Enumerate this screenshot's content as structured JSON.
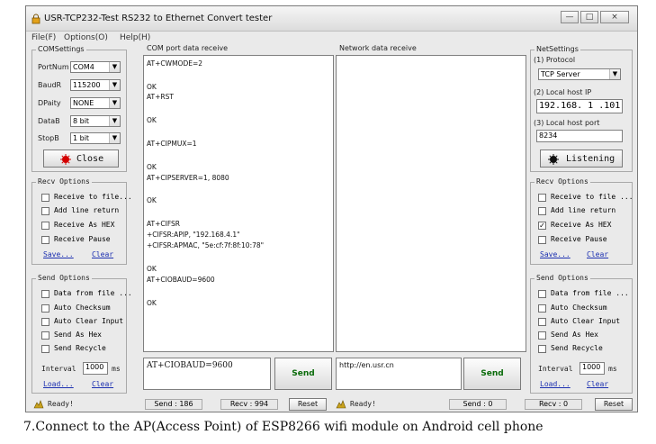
{
  "window": {
    "title": "USR-TCP232-Test  RS232 to Ethernet Convert tester",
    "min_label": "—",
    "max_label": "□",
    "close_label": "×"
  },
  "menu": [
    "File(F)",
    "Options(O)",
    "Help(H)"
  ],
  "coms": {
    "title": "COMSettings",
    "port_label": "PortNum",
    "port_value": "COM4",
    "baud_label": "BaudR",
    "baud_value": "115200",
    "parity_label": "DPaity",
    "parity_value": "NONE",
    "databits_label": "DataB",
    "databits_value": "8 bit",
    "stopbits_label": "StopB",
    "stopbits_value": "1 bit",
    "close_button": "Close"
  },
  "recv_left": {
    "title": "Recv Options",
    "items": [
      {
        "label": "Receive to file...",
        "checked": false
      },
      {
        "label": "Add line return",
        "checked": false
      },
      {
        "label": "Receive As HEX",
        "checked": false
      },
      {
        "label": "Receive Pause",
        "checked": false
      }
    ],
    "save": "Save...",
    "clear": "Clear"
  },
  "send_left": {
    "title": "Send Options",
    "items": [
      {
        "label": "Data from file ...",
        "checked": false
      },
      {
        "label": "Auto Checksum",
        "checked": false
      },
      {
        "label": "Auto Clear Input",
        "checked": false
      },
      {
        "label": "Send As Hex",
        "checked": false
      },
      {
        "label": "Send Recycle",
        "checked": false
      }
    ],
    "interval_label": "Interval",
    "interval_value": "1000",
    "interval_unit": "ms",
    "load": "Load...",
    "clear": "Clear"
  },
  "com_receive": {
    "title": "COM port data receive",
    "lines": [
      "AT+CWMODE=2",
      "",
      "OK",
      "AT+RST",
      "",
      "OK",
      "",
      "AT+CIPMUX=1",
      "",
      "OK",
      "AT+CIPSERVER=1, 8080",
      "",
      "OK",
      "",
      "AT+CIFSR",
      "+CIFSR:APIP, \"192.168.4.1\"",
      "+CIFSR:APMAC, \"5e:cf:7f:8f:10:78\"",
      "",
      "OK",
      "AT+CIOBAUD=9600",
      "",
      "OK"
    ]
  },
  "net_receive": {
    "title": "Network data receive"
  },
  "net_settings": {
    "title": "NetSettings",
    "protocol_label": "(1) Protocol",
    "protocol_value": "TCP Server",
    "host_ip_label": "(2) Local host IP",
    "host_ip_value": "192.168. 1 .101",
    "host_port_label": "(3) Local host port",
    "host_port_value": "8234",
    "listen_button": "Listening"
  },
  "recv_right": {
    "title": "Recv Options",
    "items": [
      {
        "label": "Receive to file ...",
        "checked": false
      },
      {
        "label": "Add line return",
        "checked": false
      },
      {
        "label": "Receive As HEX",
        "checked": true
      },
      {
        "label": "Receive Pause",
        "checked": false
      }
    ],
    "save": "Save...",
    "clear": "Clear"
  },
  "send_right": {
    "title": "Send Options",
    "items": [
      {
        "label": "Data from file ...",
        "checked": false
      },
      {
        "label": "Auto Checksum",
        "checked": false
      },
      {
        "label": "Auto Clear Input",
        "checked": false
      },
      {
        "label": "Send As Hex",
        "checked": false
      },
      {
        "label": "Send Recycle",
        "checked": false
      }
    ],
    "interval_label": "Interval",
    "interval_value": "1000",
    "interval_unit": "ms",
    "load": "Load...",
    "clear": "Clear"
  },
  "com_send": {
    "value": "AT+CIOBAUD=9600",
    "button": "Send"
  },
  "net_send": {
    "value": "http://en.usr.cn",
    "button": "Send"
  },
  "status_left": {
    "ready": "Ready!",
    "send": "Send : 186",
    "recv": "Recv : 994",
    "reset": "Reset"
  },
  "status_right": {
    "ready": "Ready!",
    "send": "Send : 0",
    "recv": "Recv : 0",
    "reset": "Reset"
  },
  "caption": "7.Connect to the AP(Access Point) of ESP8266 wifi module on Android cell phone",
  "colors": {
    "accent_red": "#d40000",
    "link_blue": "#1b2fb0"
  }
}
